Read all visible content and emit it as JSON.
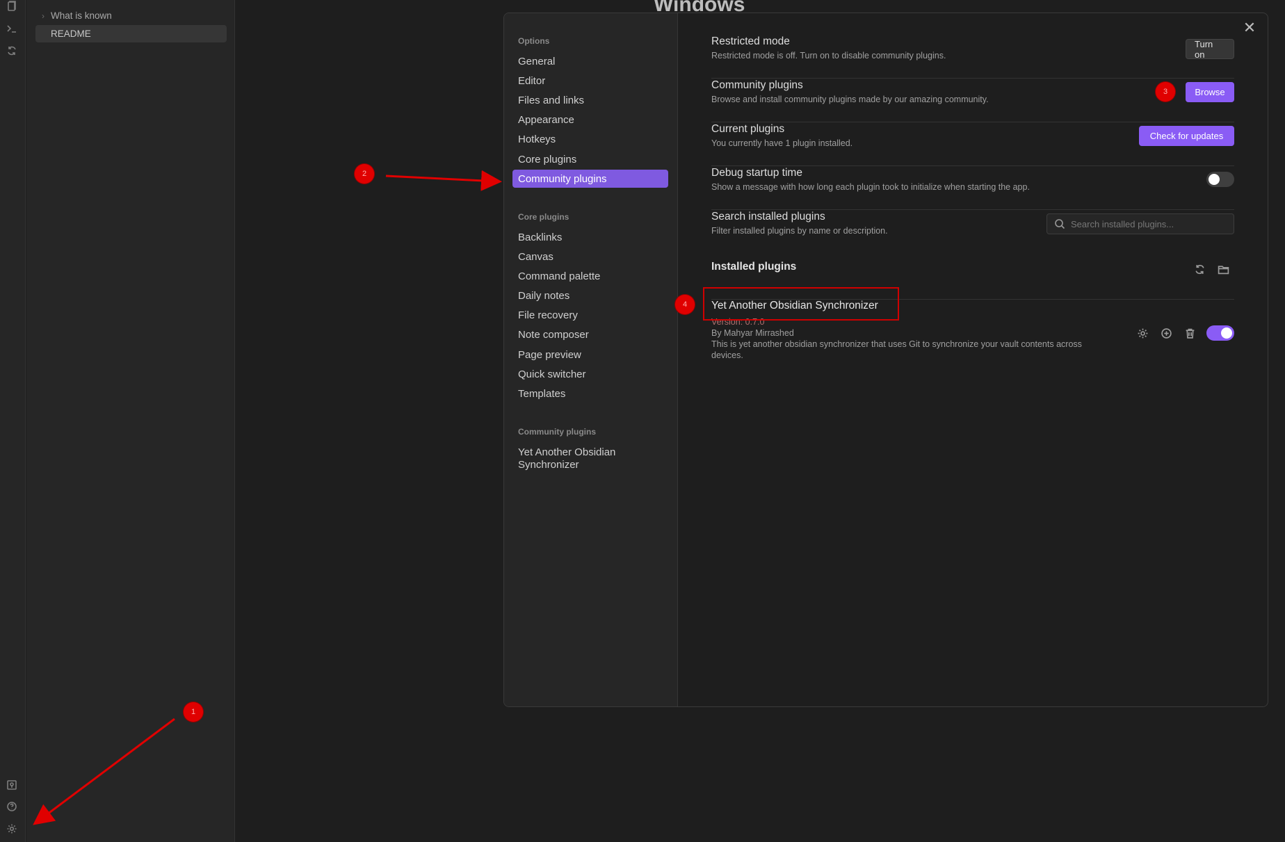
{
  "explorer": {
    "folder_label": "What is known",
    "folder_chevron": "›",
    "readme_label": "README"
  },
  "main": {
    "title": "Windows"
  },
  "modal": {
    "close": "✕",
    "sidebar": {
      "options_heading": "Options",
      "options": [
        "General",
        "Editor",
        "Files and links",
        "Appearance",
        "Hotkeys",
        "Core plugins",
        "Community plugins"
      ],
      "core_heading": "Core plugins",
      "core": [
        "Backlinks",
        "Canvas",
        "Command palette",
        "Daily notes",
        "File recovery",
        "Note composer",
        "Page preview",
        "Quick switcher",
        "Templates"
      ],
      "community_heading": "Community plugins",
      "community": [
        "Yet Another Obsidian Synchronizer"
      ]
    },
    "settings": {
      "restricted": {
        "name": "Restricted mode",
        "desc": "Restricted mode is off. Turn on to disable community plugins.",
        "button": "Turn on"
      },
      "community": {
        "name": "Community plugins",
        "desc": "Browse and install community plugins made by our amazing community.",
        "button": "Browse"
      },
      "current": {
        "name": "Current plugins",
        "desc": "You currently have 1 plugin installed.",
        "button": "Check for updates"
      },
      "debug": {
        "name": "Debug startup time",
        "desc": "Show a message with how long each plugin took to initialize when starting the app.",
        "toggle_on": false
      },
      "search": {
        "name": "Search installed plugins",
        "desc": "Filter installed plugins by name or description.",
        "placeholder": "Search installed plugins..."
      }
    },
    "installed_heading": "Installed plugins",
    "plugin": {
      "name": "Yet Another Obsidian Synchronizer",
      "version": "Version: 0.7.0",
      "author": "By Mahyar Mirrashed",
      "desc": "This is yet another obsidian synchronizer that uses Git to synchronize your vault contents across devices.",
      "enabled": true
    }
  },
  "annotations": [
    "1",
    "2",
    "3",
    "4"
  ],
  "colors": {
    "accent": "#8a5cf5",
    "annotation": "#e00000"
  }
}
